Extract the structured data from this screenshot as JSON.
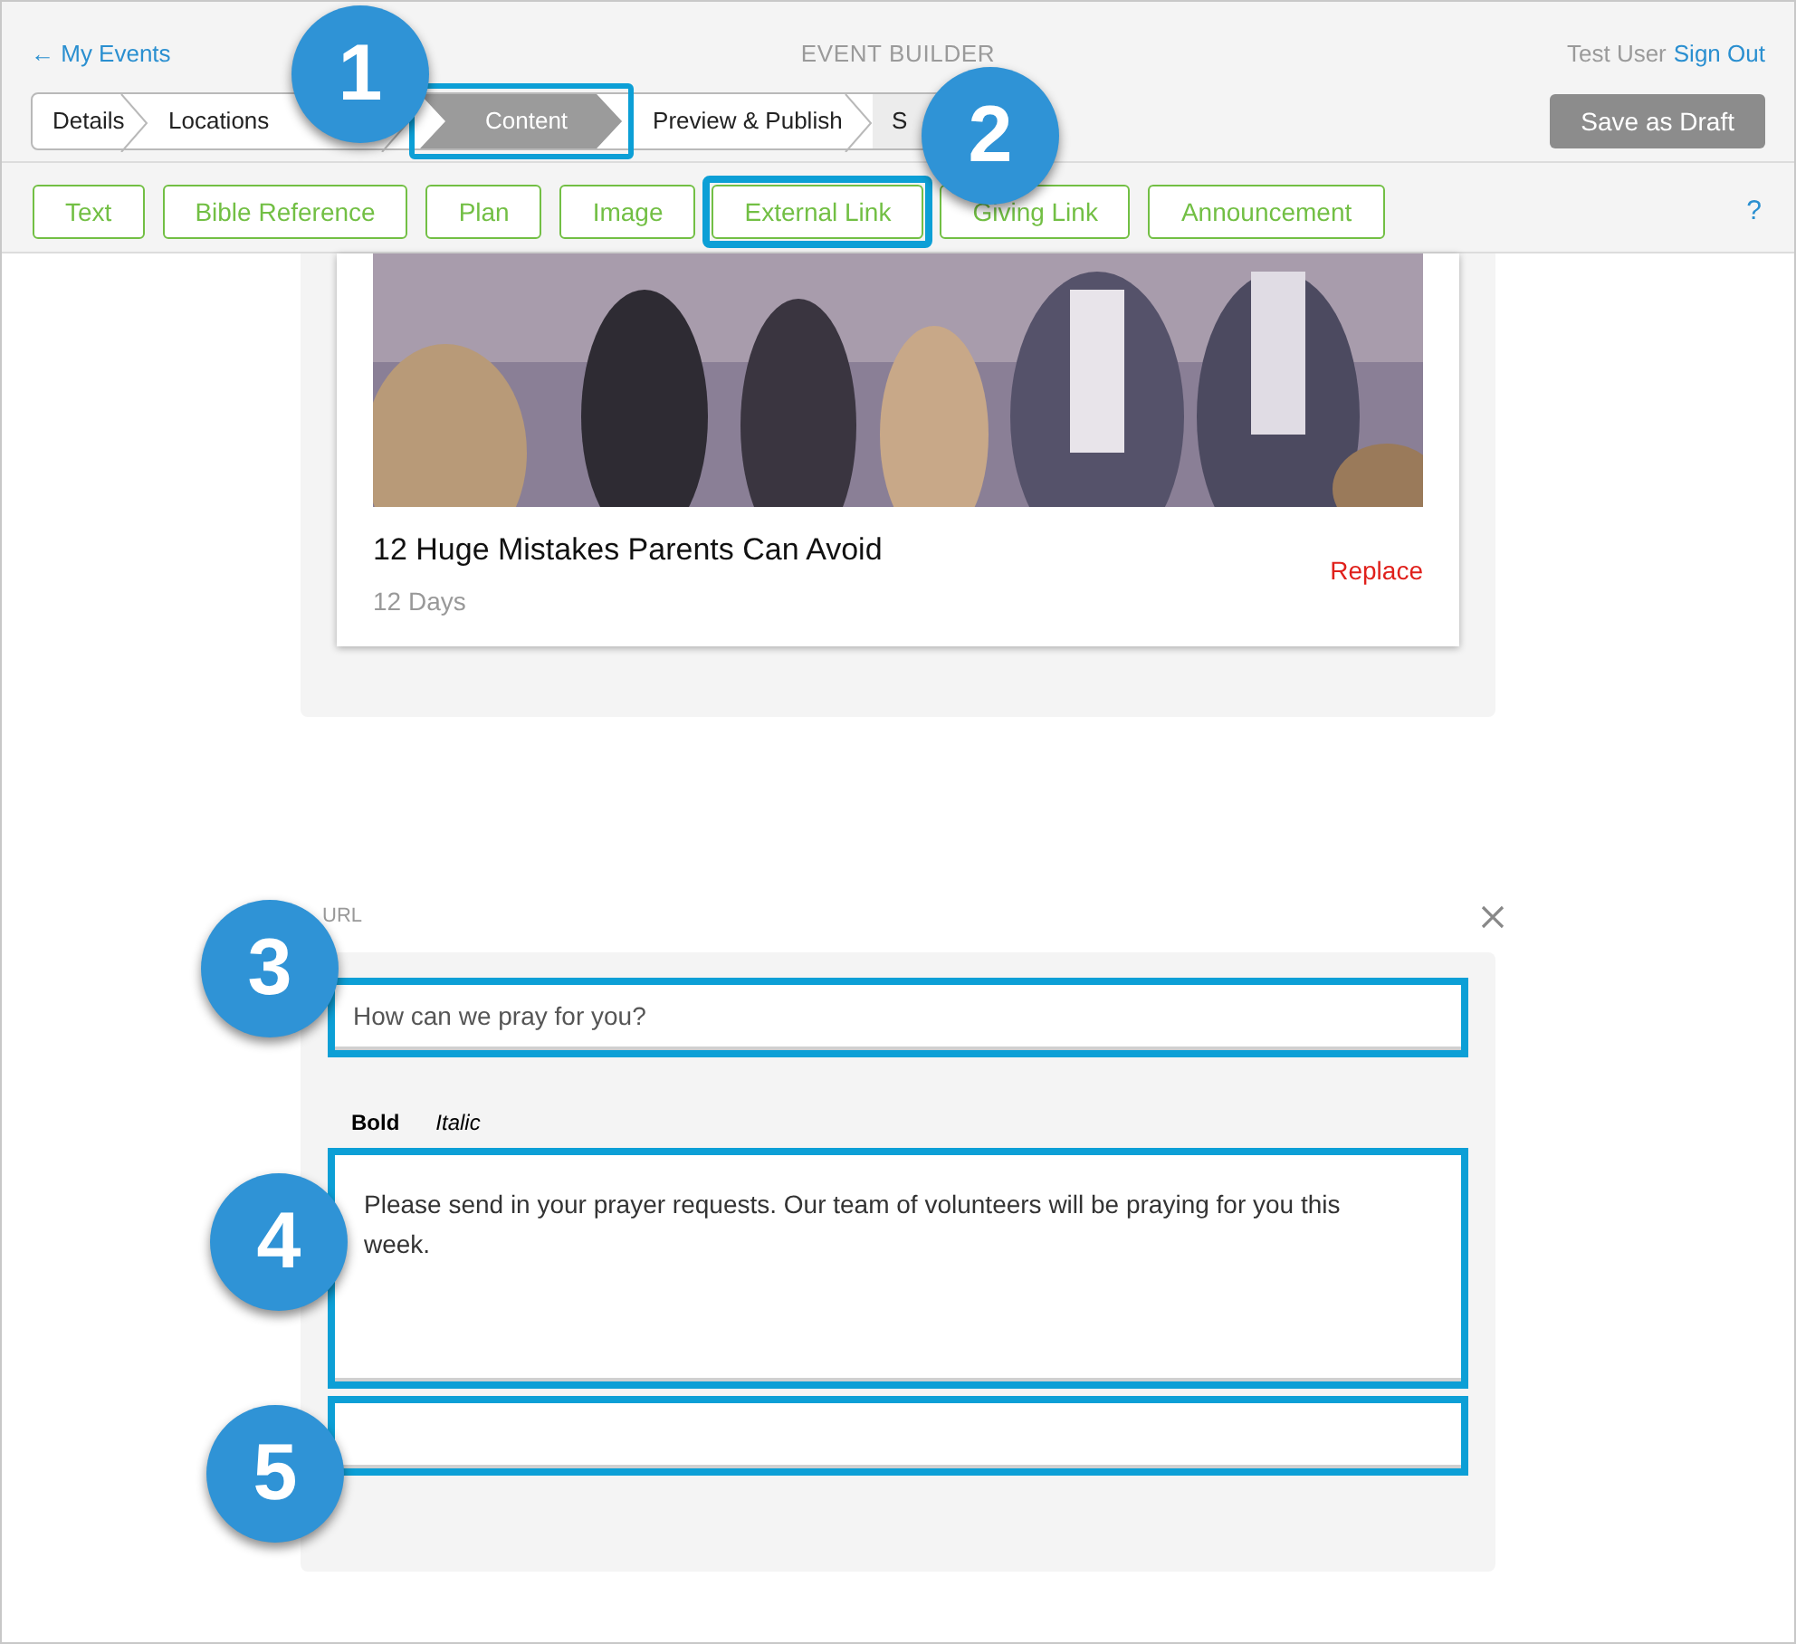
{
  "header": {
    "back_link": "← My Events",
    "title": "EVENT BUILDER",
    "user": "Test User",
    "sign_out": "Sign Out"
  },
  "steps": [
    {
      "label": "Details",
      "selected": false,
      "highlighted": false
    },
    {
      "label": "Locations",
      "selected": false,
      "highlighted": false
    },
    {
      "label": "Content",
      "selected": true,
      "highlighted": true
    },
    {
      "label": "Preview & Publish",
      "selected": false,
      "highlighted": false
    },
    {
      "label": "S",
      "selected": false,
      "highlighted": false
    }
  ],
  "save_button": "Save as Draft",
  "content_types": [
    {
      "label": "Text",
      "highlighted": false
    },
    {
      "label": "Bible Reference",
      "highlighted": false
    },
    {
      "label": "Plan",
      "highlighted": false
    },
    {
      "label": "Image",
      "highlighted": false
    },
    {
      "label": "External Link",
      "highlighted": true
    },
    {
      "label": "Giving Link",
      "highlighted": false
    },
    {
      "label": "Announcement",
      "highlighted": false
    }
  ],
  "help": "?",
  "plan_card": {
    "title": "12 Huge Mistakes Parents Can Avoid",
    "subtitle": "12 Days",
    "replace": "Replace"
  },
  "link_form": {
    "label": "URL",
    "title_field": {
      "value": "How can we pray for you?",
      "highlighted": true
    },
    "format_buttons": [
      {
        "label": "Bold",
        "kind": "bold"
      },
      {
        "label": "Italic",
        "kind": "italic"
      }
    ],
    "description_field": {
      "value": "Please send in your prayer requests. Our team of volunteers will be praying for you this week.",
      "highlighted": true
    },
    "extra_field": {
      "highlighted": true
    }
  },
  "callouts": [
    {
      "label": "1"
    },
    {
      "label": "2"
    },
    {
      "label": "3"
    },
    {
      "label": "4"
    },
    {
      "label": "5"
    }
  ]
}
